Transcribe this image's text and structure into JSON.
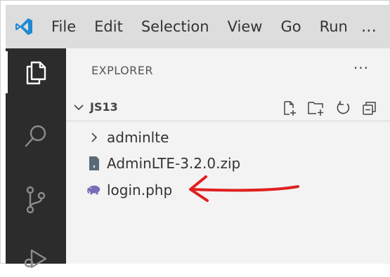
{
  "menubar": {
    "items": [
      "File",
      "Edit",
      "Selection",
      "View",
      "Go",
      "Run"
    ],
    "overflow": "…"
  },
  "activitybar": {
    "icons": [
      "files-icon",
      "search-icon",
      "source-control-icon",
      "run-debug-icon"
    ],
    "active": "files-icon"
  },
  "explorer": {
    "title": "EXPLORER",
    "more_actions": "···",
    "workspace": {
      "name": "JS13",
      "actions": [
        "new-file-icon",
        "new-folder-icon",
        "refresh-icon",
        "collapse-all-icon"
      ]
    },
    "tree": [
      {
        "label": "adminlte",
        "type": "folder",
        "expanded": false
      },
      {
        "label": "AdminLTE-3.2.0.zip",
        "type": "zip"
      },
      {
        "label": "login.php",
        "type": "php"
      }
    ]
  },
  "annotation": {
    "type": "arrow",
    "color": "#e02020",
    "points_to": "login.php"
  },
  "colors": {
    "menubar_bg": "#dddddd",
    "activitybar_bg": "#2c2c2c",
    "sidebar_bg": "#f3f3f3",
    "vscode_blue": "#1f8ad2",
    "php_purple": "#7a6ab8",
    "arrow_red": "#e02020"
  }
}
